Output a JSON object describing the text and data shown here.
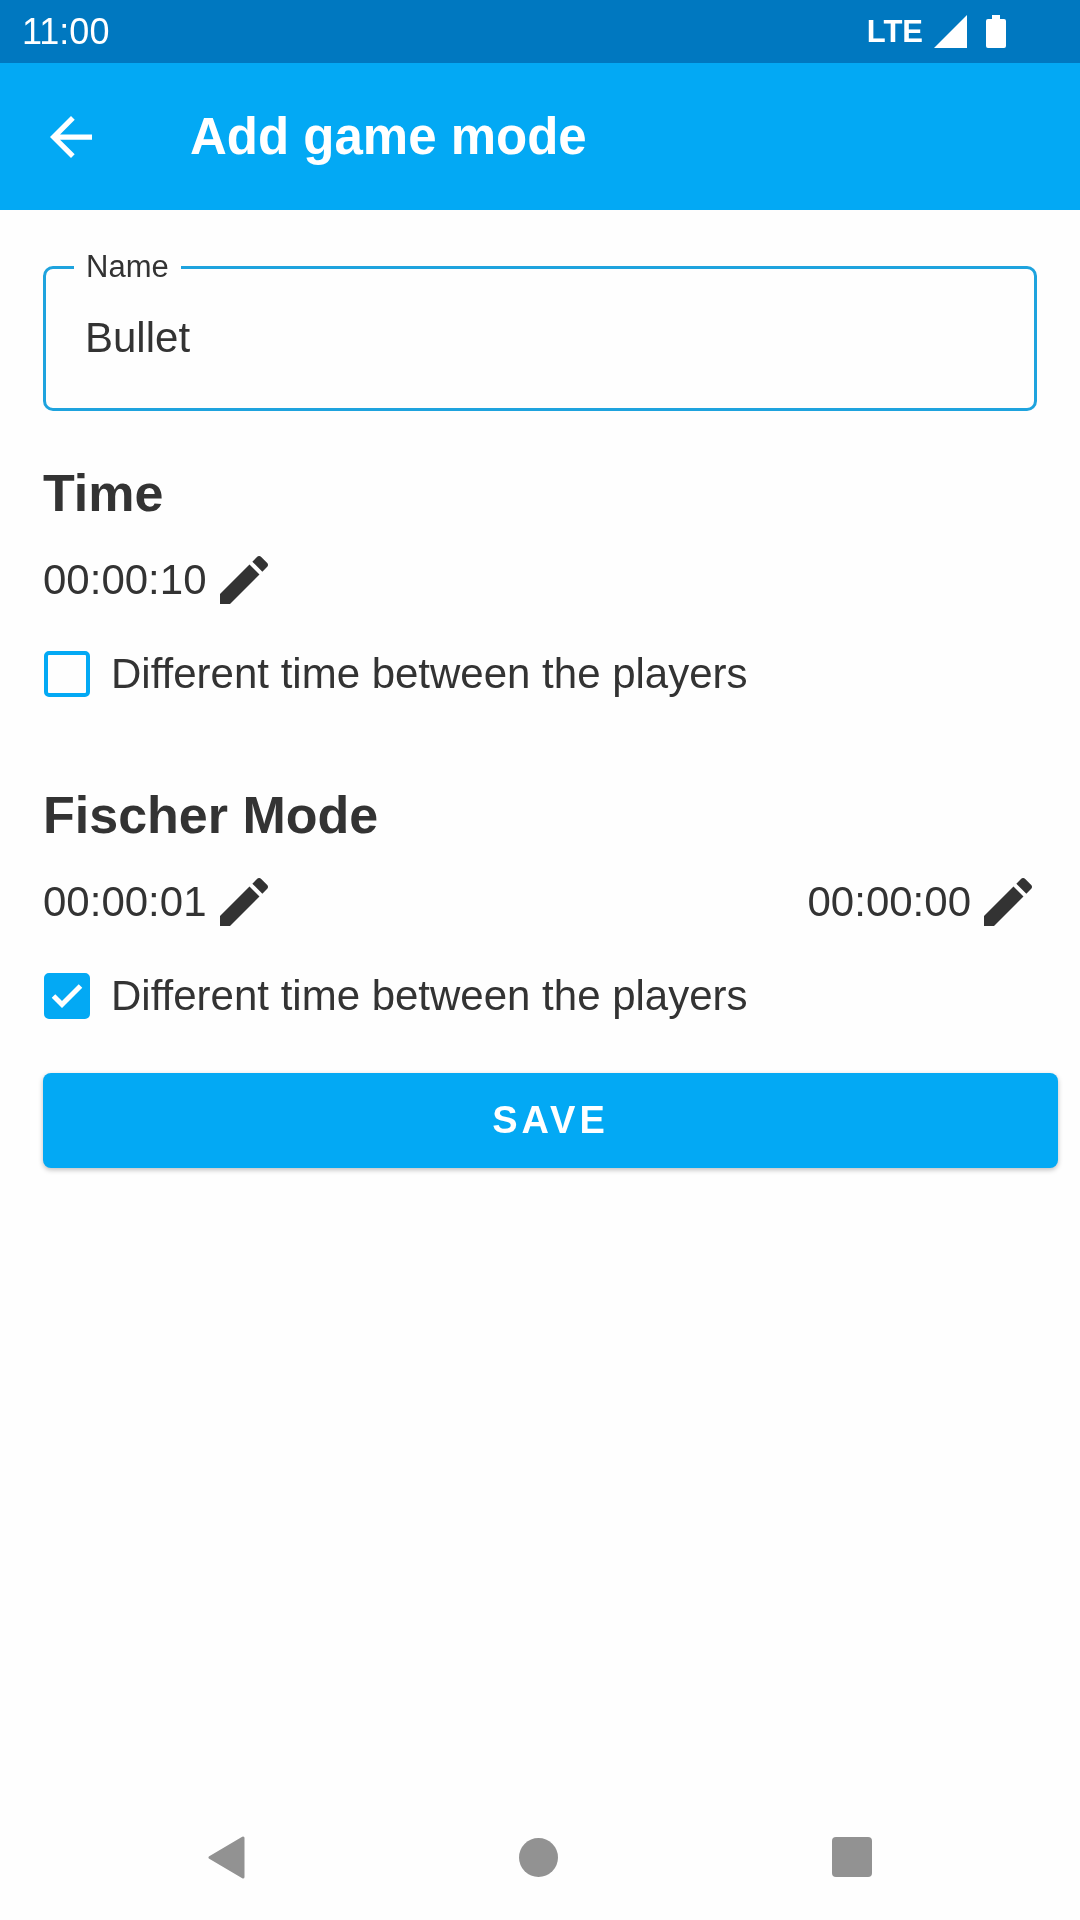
{
  "status_bar": {
    "time": "11:00",
    "network": "LTE"
  },
  "app_bar": {
    "title": "Add game mode"
  },
  "name_field": {
    "label": "Name",
    "value": "Bullet",
    "focused": true
  },
  "sections": [
    {
      "title": "Time",
      "times": [
        "00:00:10"
      ],
      "option": {
        "label": "Different time between the players",
        "checked": false
      }
    },
    {
      "title": "Fischer Mode",
      "times": [
        "00:00:01",
        "00:00:00"
      ],
      "option": {
        "label": "Different time between the players",
        "checked": true
      }
    }
  ],
  "save_button": {
    "label": "SAVE"
  }
}
